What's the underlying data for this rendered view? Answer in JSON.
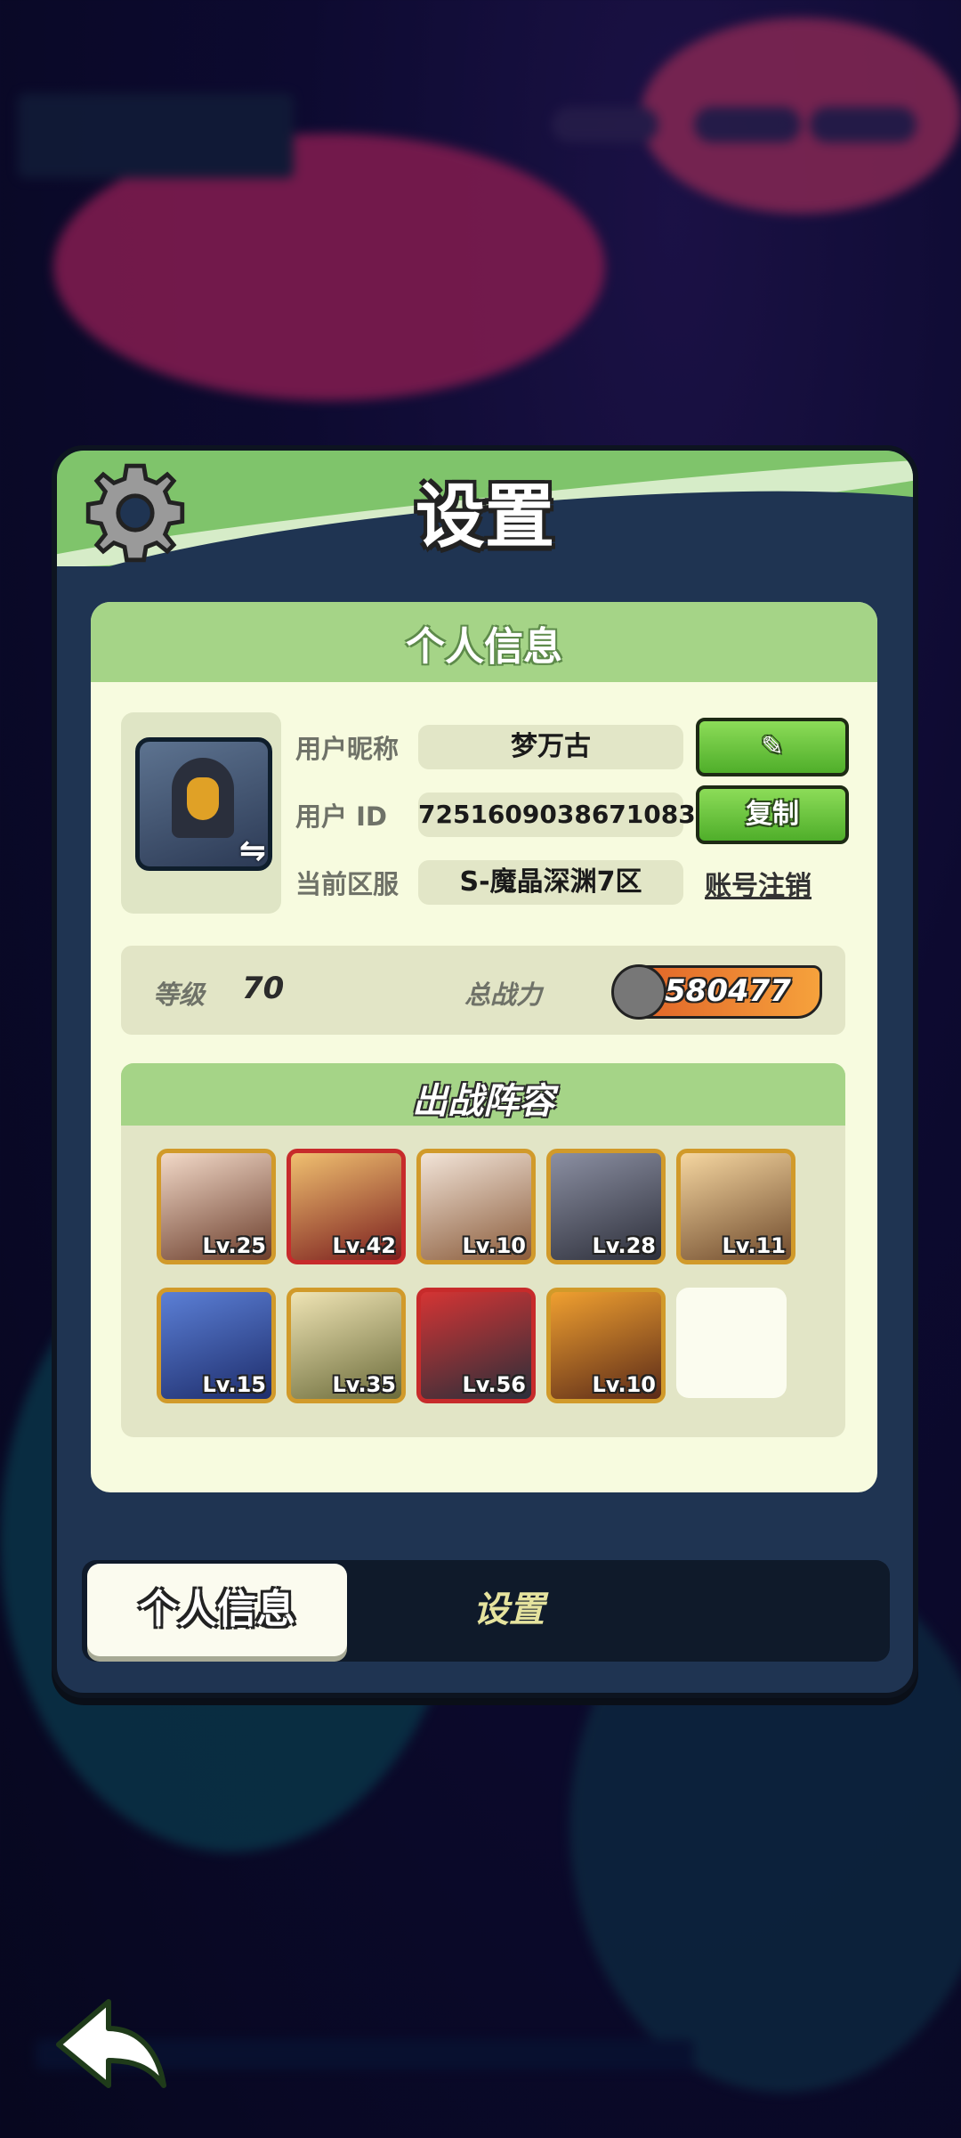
{
  "dialog": {
    "title": "设置",
    "section_title": "个人信息",
    "nickname_label": "用户昵称",
    "nickname": "梦万古",
    "uid_label": "用户 ID",
    "uid": "7251609038671083",
    "server_label": "当前区服",
    "server": "S-魔晶深渊7区",
    "edit_icon": "pencil-icon",
    "copy_label": "复制",
    "delete_account_label": "账号注销",
    "level_label": "等级",
    "level": "70",
    "power_label": "总战力",
    "power": "580477",
    "lineup_title": "出战阵容",
    "heroes": [
      {
        "level": "Lv.25",
        "border": "gold"
      },
      {
        "level": "Lv.42",
        "border": "red"
      },
      {
        "level": "Lv.10",
        "border": "gold"
      },
      {
        "level": "Lv.28",
        "border": "gold"
      },
      {
        "level": "Lv.11",
        "border": "gold"
      },
      {
        "level": "Lv.15",
        "border": "gold"
      },
      {
        "level": "Lv.35",
        "border": "gold"
      },
      {
        "level": "Lv.56",
        "border": "red"
      },
      {
        "level": "Lv.10",
        "border": "gold"
      }
    ]
  },
  "tabs": {
    "personal": "个人信息",
    "settings": "设置"
  },
  "colors": {
    "header_green": "#7fc46b",
    "card_bg": "#f7fbdf",
    "button_green": "#4fae2a",
    "panel_dark": "#1f3452"
  }
}
